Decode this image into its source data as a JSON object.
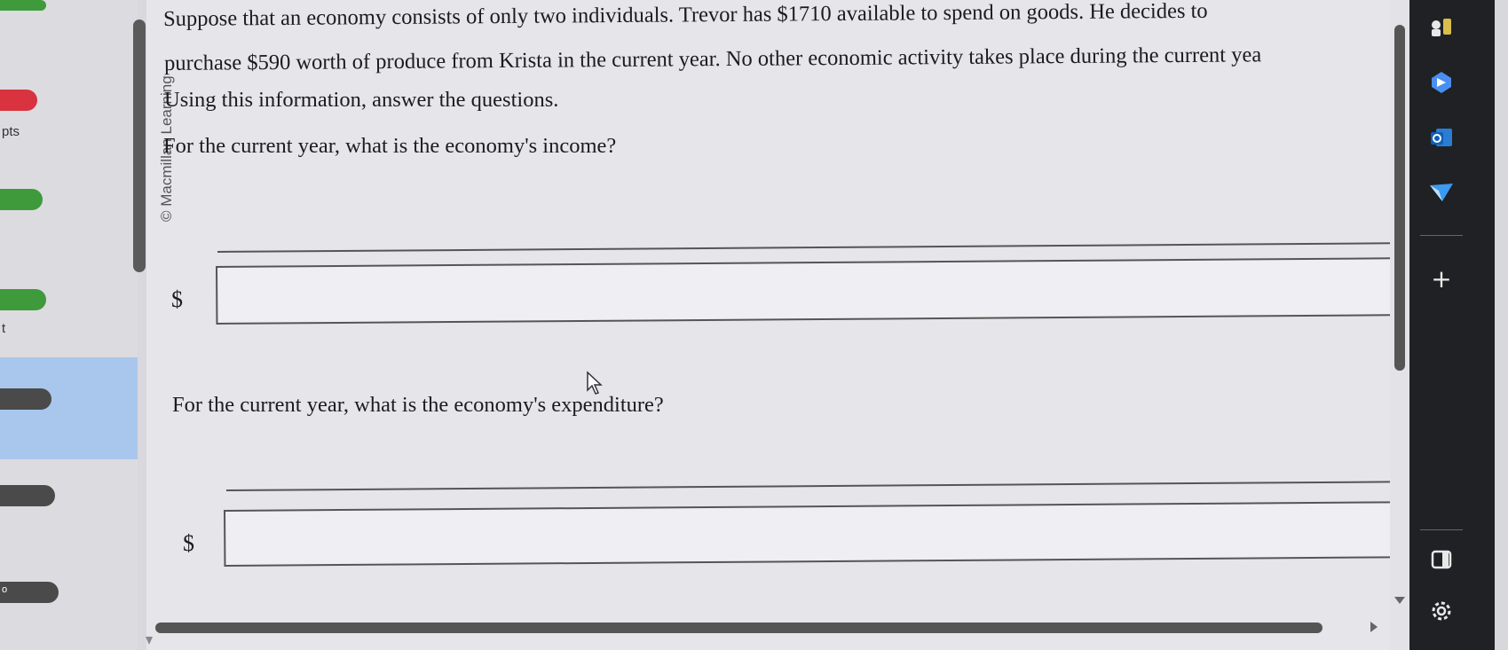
{
  "left_nav": {
    "pts_label": "pts",
    "t_label": "t",
    "item_glyph": "o"
  },
  "watermark": "© Macmillan Learning",
  "question": {
    "line1": "Suppose that an economy consists of only two individuals. Trevor has $1710 available to spend on goods. He decides to",
    "line2": "purchase $590 worth of produce from Krista in the current year. No other economic activity takes place during the current yea",
    "line3": "Using this information, answer the questions.",
    "q1": "For the current year, what is the economy's income?",
    "q2": "For the current year, what is the economy's expenditure?",
    "currency": "$",
    "answer1": "",
    "answer2": ""
  },
  "sidebar": {
    "icons": [
      "chess-icon",
      "copilot-icon",
      "outlook-icon",
      "send-icon",
      "plus-icon",
      "panel-icon",
      "gear-icon"
    ],
    "plus_label": "+"
  },
  "colors": {
    "red_pill": "#d8333f",
    "green_pill": "#3f9a3c",
    "dark_pill": "#4a4a4a",
    "selected_bg": "#a9c7ec",
    "sidebar_bg": "#202124"
  }
}
